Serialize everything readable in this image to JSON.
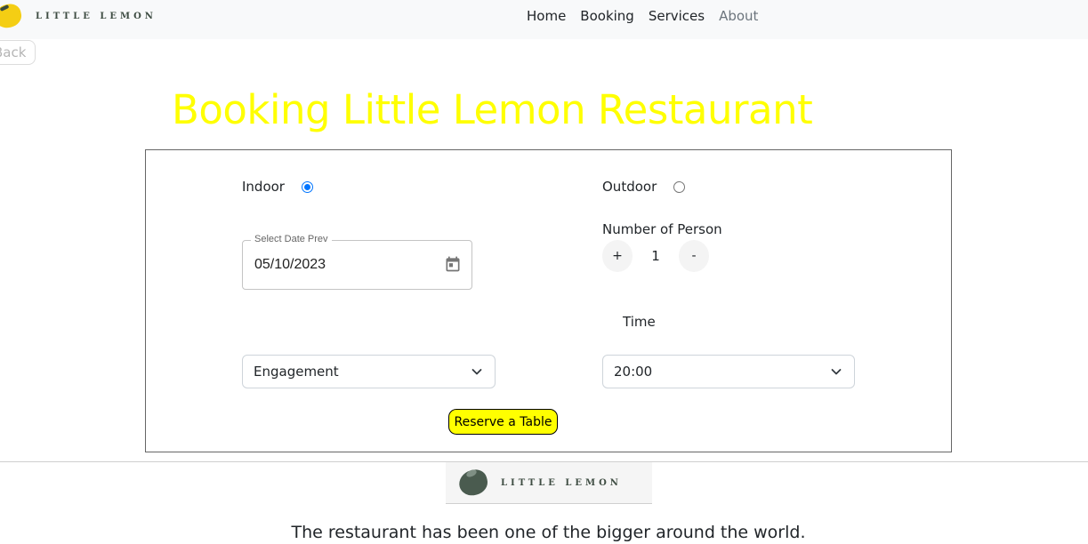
{
  "nav": {
    "brand": "LITTLE LEMON",
    "links": [
      "Home",
      "Booking",
      "Services",
      "About"
    ],
    "back_label": "Back"
  },
  "page": {
    "title": "Booking Little Lemon Restaurant"
  },
  "form": {
    "indoor_label": "Indoor",
    "indoor_selected": true,
    "outdoor_label": "Outdoor",
    "outdoor_selected": false,
    "date_legend": "Select Date Prev",
    "date_value": "05/10/2023",
    "persons_label": "Number of Person",
    "persons_plus": "+",
    "persons_value": "1",
    "persons_minus": "-",
    "time_label": "Time",
    "occasion_value": "Engagement",
    "time_value": "20:00",
    "reserve_label": "Reserve a Table"
  },
  "footer": {
    "brand": "LITTLE LEMON",
    "text": "The restaurant has been one of the bigger around the world."
  },
  "colors": {
    "title": "#ffff00",
    "reserve_button": "#ffff00",
    "radio_checked": "#0075ff"
  }
}
